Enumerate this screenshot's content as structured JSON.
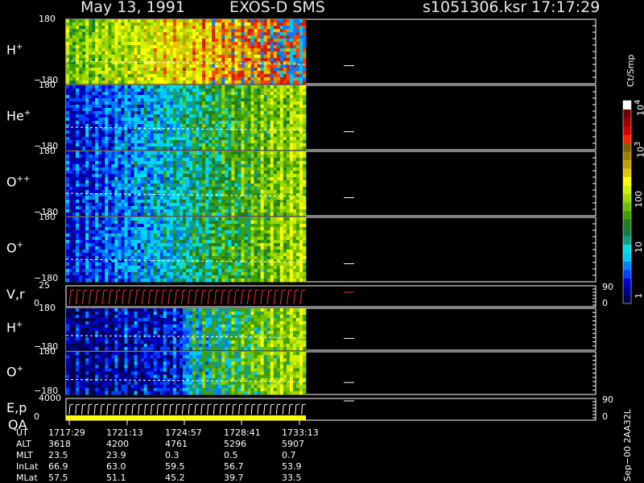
{
  "header": {
    "date": "May 13, 1991",
    "instrument": "EXOS-D SMS",
    "file": "s1051306.ksr",
    "time": "17:17:29"
  },
  "chart_data": {
    "type": "heatmap",
    "panels": [
      {
        "label": "H",
        "sup": "+",
        "ymax": "180",
        "ymin": "−180",
        "kind": "spectro",
        "scheme": "hot"
      },
      {
        "label": "He",
        "sup": "+",
        "ymax": "180",
        "ymin": "−180",
        "kind": "spectro",
        "scheme": "mid"
      },
      {
        "label": "O",
        "sup": "++",
        "ymax": "180",
        "ymin": "−180",
        "kind": "spectro",
        "scheme": "mid"
      },
      {
        "label": "O",
        "sup": "+",
        "ymax": "180",
        "ymin": "−180",
        "kind": "spectro",
        "scheme": "mid"
      },
      {
        "label": "V,r",
        "sup": "",
        "ymax": "25",
        "ymin": "0",
        "kind": "line",
        "right_max": "90",
        "right_min": "0"
      },
      {
        "label": "H",
        "sup": "+",
        "ymax": "180",
        "ymin": "−180",
        "kind": "spectro",
        "scheme": "low"
      },
      {
        "label": "O",
        "sup": "+",
        "ymax": "180",
        "ymin": "−180",
        "kind": "spectro",
        "scheme": "low"
      },
      {
        "label": "E,p",
        "sup": "",
        "label2": "QA",
        "ymax": "4000",
        "ymin": "0",
        "kind": "line2",
        "right_max": "90",
        "right_min": "0"
      }
    ],
    "colorbar": {
      "unit": "Ct/Smp",
      "tick_labels": [
        "1",
        "10",
        "100",
        "10",
        "10"
      ],
      "tick_sups": [
        "",
        "",
        "",
        "3",
        "4"
      ],
      "colors": [
        "#00004a",
        "#000090",
        "#0000d0",
        "#0040ff",
        "#0080ff",
        "#00c8ff",
        "#00e0e0",
        "#10a080",
        "#108040",
        "#208020",
        "#40a000",
        "#70c000",
        "#a0d800",
        "#d0f000",
        "#ffff00",
        "#e0c800",
        "#c0a000",
        "#a08000",
        "#806000",
        "#ff2000",
        "#d00000",
        "#a00000",
        "#700000",
        "#ffffff"
      ]
    },
    "time_axis": {
      "rows": [
        {
          "name": "UT",
          "values": [
            "1717:29",
            "1721:13",
            "1724:57",
            "1728:41",
            "1733:13"
          ]
        },
        {
          "name": "ALT",
          "values": [
            "3618",
            "4200",
            "4761",
            "5296",
            "5907"
          ]
        },
        {
          "name": "MLT",
          "values": [
            "23.5",
            "23.9",
            "0.3",
            "0.5",
            "0.7"
          ]
        },
        {
          "name": "InLat",
          "values": [
            "66.9",
            "63.0",
            "59.5",
            "56.7",
            "53.9"
          ]
        },
        {
          "name": "MLat",
          "values": [
            "57.5",
            "51.1",
            "45.2",
            "39.7",
            "33.5"
          ]
        }
      ]
    },
    "side_note": "Sep−00 2AA32L"
  }
}
